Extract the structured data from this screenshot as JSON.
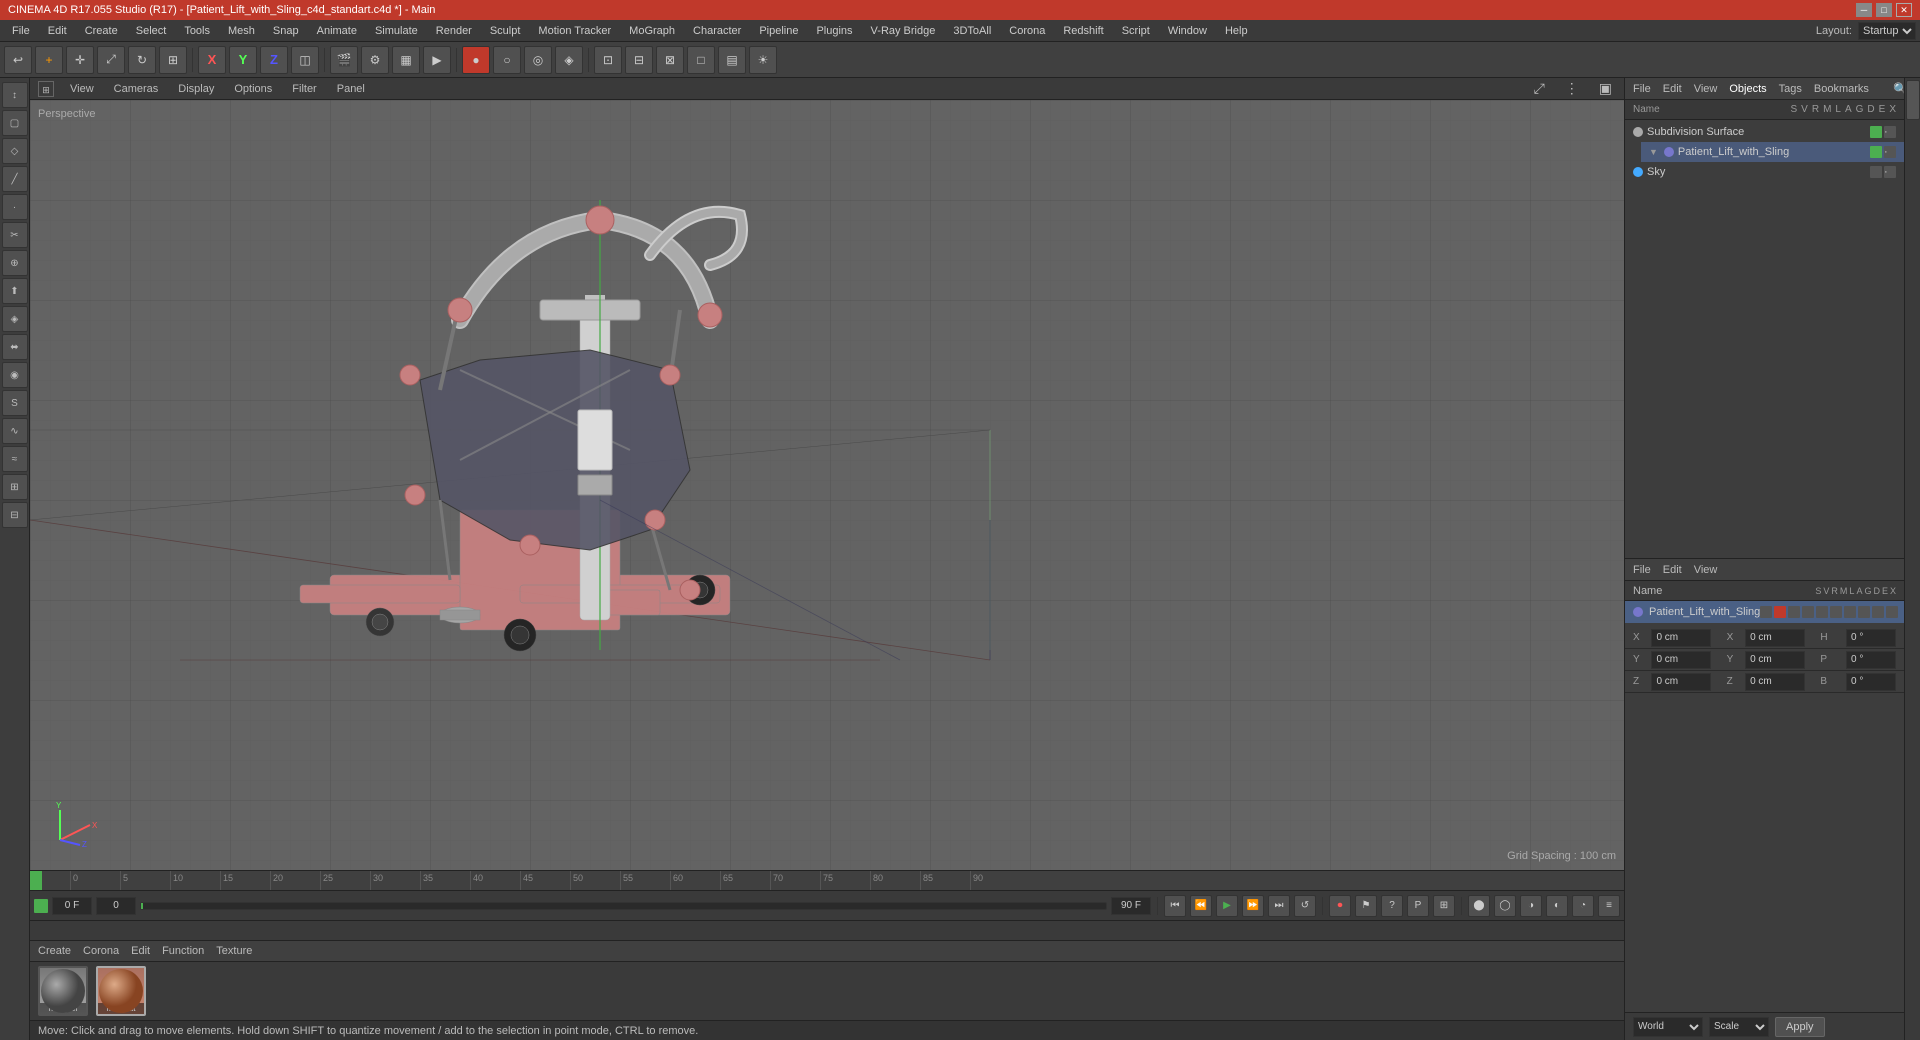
{
  "titleBar": {
    "title": "CINEMA 4D R17.055 Studio (R17) - [Patient_Lift_with_Sling_c4d_standart.c4d *] - Main",
    "minimize": "─",
    "maximize": "□",
    "close": "✕"
  },
  "menuBar": {
    "items": [
      "File",
      "Edit",
      "Create",
      "Select",
      "Tools",
      "Mesh",
      "Snap",
      "Animate",
      "Simulate",
      "Render",
      "Sculpt",
      "Motion Tracker",
      "MoGraph",
      "Character",
      "Pipeline",
      "Plugins",
      "V-Ray Bridge",
      "3DToAll",
      "Corona",
      "Redshift",
      "Script",
      "Window",
      "Help"
    ]
  },
  "layout": {
    "label": "Layout:",
    "value": "Startup"
  },
  "viewport": {
    "label": "Perspective",
    "gridSpacing": "Grid Spacing : 100 cm",
    "headerTabs": [
      "View",
      "Cameras",
      "Display",
      "Options",
      "Filter",
      "Panel"
    ]
  },
  "rightPanel": {
    "topTabs": [
      "File",
      "Edit",
      "View",
      "Objects",
      "Tags",
      "Bookmarks"
    ],
    "objects": [
      {
        "name": "Subdivision Surface",
        "color": "#aaaaaa",
        "indent": 0,
        "type": "modifier"
      },
      {
        "name": "Patient_Lift_with_Sling",
        "color": "#7777cc",
        "indent": 1,
        "type": "group"
      },
      {
        "name": "Sky",
        "color": "#44aaff",
        "indent": 0,
        "type": "sky"
      }
    ],
    "bottomTabs": [
      "File",
      "Edit",
      "View"
    ],
    "attrTabs": [
      "Name"
    ],
    "selectedObject": "Patient_Lift_with_Sling",
    "colHeaders": [
      "S",
      "V",
      "R",
      "M",
      "L",
      "A",
      "G",
      "D",
      "E",
      "X"
    ]
  },
  "coordinates": {
    "x": {
      "label": "X",
      "value": "0 cm",
      "label2": "X",
      "value2": "0 cm",
      "label3": "H",
      "value3": "0°"
    },
    "y": {
      "label": "Y",
      "value": "0 cm",
      "label2": "Y",
      "value2": "0 cm",
      "label3": "P",
      "value3": "0°"
    },
    "z": {
      "label": "Z",
      "value": "0 cm",
      "label2": "Z",
      "value2": "0 cm",
      "label3": "B",
      "value3": "0°"
    }
  },
  "attrBottom": {
    "worldLabel": "World",
    "scaleLabel": "Scale",
    "applyLabel": "Apply"
  },
  "timeline": {
    "startFrame": "0 F",
    "currentFrame": "0",
    "endFrame": "90 F",
    "ticks": [
      "0",
      "5",
      "10",
      "15",
      "20",
      "25",
      "30",
      "35",
      "40",
      "45",
      "50",
      "55",
      "60",
      "65",
      "70",
      "75",
      "80",
      "85",
      "90"
    ]
  },
  "materials": [
    {
      "id": "mat_boi",
      "label": "mat_boi",
      "colorTop": "#555",
      "colorBottom": "#888"
    },
    {
      "id": "mat_pat",
      "label": "mat_pat",
      "colorTop": "#cc7755",
      "colorBottom": "#aa5533"
    }
  ],
  "bottomTabs": [
    "Create",
    "Corona",
    "Edit",
    "Function",
    "Texture"
  ],
  "statusBar": {
    "text": "Move: Click and drag to move elements. Hold down SHIFT to quantize movement / add to the selection in point mode, CTRL to remove."
  }
}
